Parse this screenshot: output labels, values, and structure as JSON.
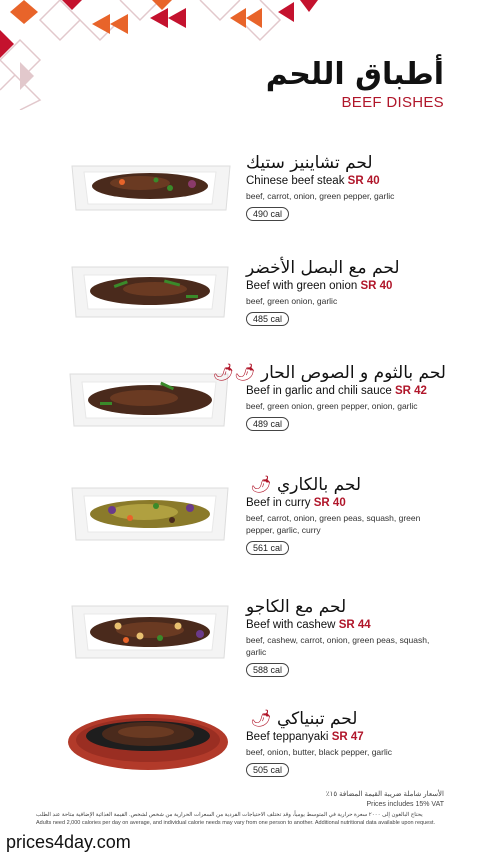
{
  "header": {
    "title_ar": "أطباق اللحم",
    "title_en": "BEEF DISHES"
  },
  "colors": {
    "accent": "#b0162a",
    "pattern": [
      "#c4122e",
      "#e8642a",
      "#d8c4c4"
    ]
  },
  "dishes": [
    {
      "name_ar": "لحم تشاينيز ستيك",
      "name_en": "Chinese beef steak",
      "price": "SR 40",
      "ingredients": "beef, carrot, onion, green pepper, garlic",
      "calories": "490 cal",
      "spicy": 0
    },
    {
      "name_ar": "لحم مع البصل الأخضر",
      "name_en": "Beef with green onion",
      "price": "SR 40",
      "ingredients": "beef, green onion, garlic",
      "calories": "485 cal",
      "spicy": 0
    },
    {
      "name_ar": "لحم بالثوم و الصوص الحار",
      "name_en": "Beef in garlic and chili sauce",
      "price": "SR 42",
      "ingredients": "beef, green onion, green pepper, onion, garlic",
      "calories": "489 cal",
      "spicy": 2
    },
    {
      "name_ar": "لحم بالكاري",
      "name_en": "Beef in curry",
      "price": "SR 40",
      "ingredients": "beef, carrot, onion, green peas, squash, green pepper, garlic, curry",
      "calories": "561 cal",
      "spicy": 1
    },
    {
      "name_ar": "لحم مع الكاجو",
      "name_en": "Beef with cashew",
      "price": "SR 44",
      "ingredients": "beef, cashew, carrot, onion, green peas, squash, garlic",
      "calories": "588 cal",
      "spicy": 0
    },
    {
      "name_ar": "لحم تبنياكي",
      "name_en": "Beef teppanyaki",
      "price": "SR 47",
      "ingredients": "beef, onion, butter, black pepper, garlic",
      "calories": "505 cal",
      "spicy": 1
    }
  ],
  "footer": {
    "vat_ar": "الأسعار شاملة ضريبة القيمة المضافة ١٥٪",
    "vat_en": "Prices includes 15% VAT",
    "note_ar": "يحتاج البالغون إلى ٢٠٠٠ سعرة حرارية في المتوسط يومياً، وقد تختلف الاحتياجات الفردية من السعرات الحرارية من شخص لشخص. القيمة الغذائية الإضافية متاحة عند الطلب",
    "note_en": "Adults need 2,000 calories per day on average, and individual calorie needs may vary from one person to another. Additional nutritional data available upon request."
  },
  "watermark": "prices4day.com"
}
